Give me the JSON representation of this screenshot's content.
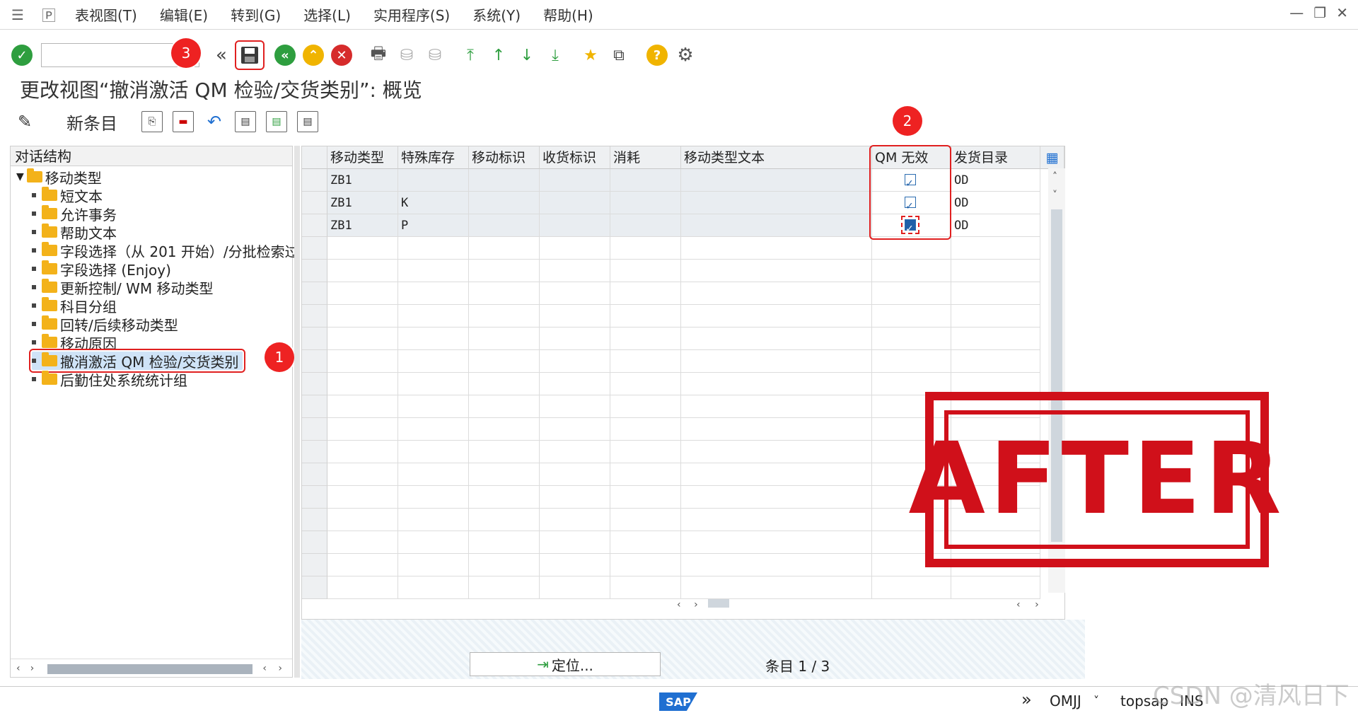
{
  "menubar": {
    "items": [
      "表视图(T)",
      "编辑(E)",
      "转到(G)",
      "选择(L)",
      "实用程序(S)",
      "系统(Y)",
      "帮助(H)"
    ]
  },
  "toolbar": {
    "command_value": "",
    "badge_3": "3"
  },
  "title": "更改视图“撤消激活 QM 检验/交货类别”: 概览",
  "app_toolbar": {
    "new_entries": "新条目"
  },
  "tree": {
    "header": "对话结构",
    "root": "移动类型",
    "children": [
      "短文本",
      "允许事务",
      "帮助文本",
      "字段选择（从 201 开始）/分批检索过",
      "字段选择 (Enjoy)",
      "更新控制/ WM 移动类型",
      "科目分组",
      "回转/后续移动类型",
      "移动原因",
      "撤消激活 QM 检验/交货类别",
      "后勤住处系统统计组"
    ],
    "badge_1": "1"
  },
  "table": {
    "columns": [
      "移动类型",
      "特殊库存",
      "移动标识",
      "收货标识",
      "消耗",
      "移动类型文本",
      "QM 无效",
      "发货目录"
    ],
    "rows": [
      {
        "mvt": "ZB1",
        "special": "",
        "mvt_ind": "",
        "gr_ind": "",
        "cons": "",
        "text": "",
        "qm_inactive": true,
        "catalog": "OD"
      },
      {
        "mvt": "ZB1",
        "special": "K",
        "mvt_ind": "",
        "gr_ind": "",
        "cons": "",
        "text": "",
        "qm_inactive": true,
        "catalog": "OD"
      },
      {
        "mvt": "ZB1",
        "special": "P",
        "mvt_ind": "",
        "gr_ind": "",
        "cons": "",
        "text": "",
        "qm_inactive": true,
        "catalog": "OD"
      }
    ],
    "badge_2": "2"
  },
  "bottom": {
    "locate_button": "定位...",
    "entry_count": "条目 1 / 3"
  },
  "statusbar": {
    "logo": "SAP",
    "transaction": "OMJJ",
    "server": "topsap",
    "mode": "INS"
  },
  "stamp": "AFTER",
  "watermark": "CSDN @清风日下"
}
